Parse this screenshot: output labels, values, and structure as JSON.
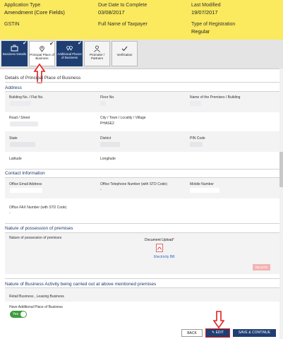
{
  "header": {
    "app_type_label": "Application Type",
    "app_type_value": "Amendment (Core Fields)",
    "due_label": "Due Date to Complete",
    "due_value": "03/08/2017",
    "last_modified_label": "Last Modified",
    "last_modified_value": "19/07/2017",
    "gstin_label": "GSTIN",
    "taxpayer_label": "Full Name of Taxpayer",
    "reg_type_label": "Type of Registration",
    "reg_type_value": "Regular"
  },
  "tabs": [
    {
      "label": "Business Details",
      "icon": "briefcase-icon",
      "state": "done"
    },
    {
      "label": "Principal Place of Business",
      "icon": "location-pin-icon",
      "state": "active"
    },
    {
      "label": "Additional Places of Business",
      "icon": "locations-icon",
      "state": "done"
    },
    {
      "label": "Promoter / Partners",
      "icon": "person-icon",
      "state": "pending"
    },
    {
      "label": "Verification",
      "icon": "checkmark-icon",
      "state": "pending"
    }
  ],
  "page_title": "Details of Principal Place of Business",
  "address": {
    "heading": "Address",
    "building_label": "Building No. / Flat No.",
    "floor_label": "Floor No.",
    "premises_label": "Name of the Premises / Building",
    "road_label": "Road / Street",
    "city_label": "City / Town / Locality / Village",
    "city_value": "PHASE2",
    "state_label": "State",
    "district_label": "District",
    "pin_label": "PIN Code",
    "lat_label": "Latitude",
    "lon_label": "Longitude"
  },
  "contact": {
    "heading": "Contact Information",
    "email_label": "Office Email Address",
    "phone_label": "Office Telephone Number (with STD Code)",
    "phone_value": "-",
    "mobile_label": "Mobile Number",
    "fax_label": "Office FAX Number (with STD Code)",
    "fax_value": "-"
  },
  "possession": {
    "heading": "Nature of possession of premises",
    "field_label": "Nature of possession of premises",
    "doc_label": "Document Upload",
    "doc_required": "*",
    "doc_link": "Electricity Bill",
    "delete_label": "DELETE"
  },
  "activity": {
    "heading": "Nature of Business Activity being carried out at above mentioned premises",
    "value": "Retail Business , Leasing Business",
    "additional_label": "Have Additional Place of Business",
    "toggle_value": "Yes"
  },
  "buttons": {
    "back": "BACK",
    "edit": "EDIT",
    "save": "SAVE & CONTINUE"
  },
  "colors": {
    "header_bg": "#fbe95e",
    "primary": "#1f3f73",
    "section_heading": "#1e3a6d",
    "annotation_red": "#e0211d",
    "toggle_green": "#3d9b3d"
  }
}
